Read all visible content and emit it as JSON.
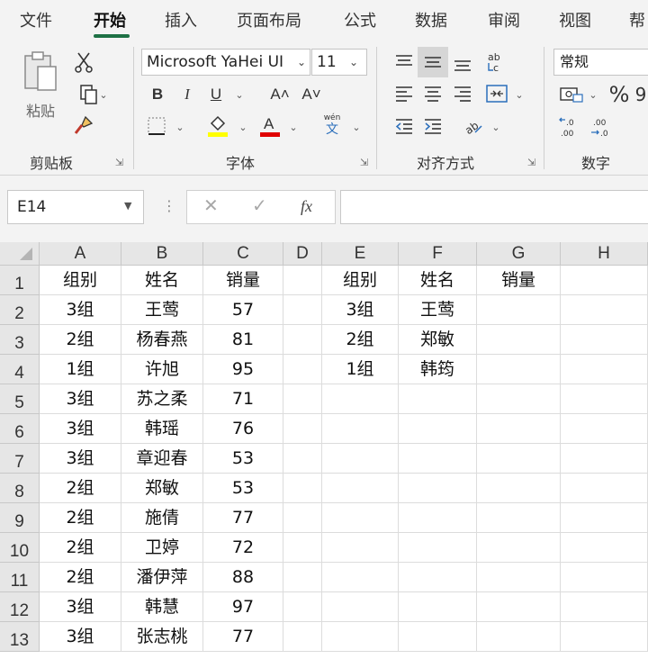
{
  "tabs": [
    "文件",
    "开始",
    "插入",
    "页面布局",
    "公式",
    "数据",
    "审阅",
    "视图",
    "帮"
  ],
  "active_tab_index": 1,
  "ribbon": {
    "clipboard": {
      "paste_label": "粘贴",
      "group_label": "剪贴板"
    },
    "font": {
      "font_name": "Microsoft YaHei UI",
      "font_size": "11",
      "group_label": "字体",
      "phonetic_label": "wén"
    },
    "alignment": {
      "group_label": "对齐方式"
    },
    "number": {
      "format": "常规",
      "group_label": "数字",
      "percent": "%"
    }
  },
  "formula_bar": {
    "name_box": "E14",
    "fx": "fx",
    "formula": ""
  },
  "columns": [
    "A",
    "B",
    "C",
    "D",
    "E",
    "F",
    "G",
    "H"
  ],
  "rows": [
    {
      "num": "1",
      "cells": [
        "组别",
        "姓名",
        "销量",
        "",
        "组别",
        "姓名",
        "销量",
        ""
      ]
    },
    {
      "num": "2",
      "cells": [
        "3组",
        "王莺",
        "57",
        "",
        "3组",
        "王莺",
        "",
        ""
      ]
    },
    {
      "num": "3",
      "cells": [
        "2组",
        "杨春燕",
        "81",
        "",
        "2组",
        "郑敏",
        "",
        ""
      ]
    },
    {
      "num": "4",
      "cells": [
        "1组",
        "许旭",
        "95",
        "",
        "1组",
        "韩筠",
        "",
        ""
      ]
    },
    {
      "num": "5",
      "cells": [
        "3组",
        "苏之柔",
        "71",
        "",
        "",
        "",
        "",
        ""
      ]
    },
    {
      "num": "6",
      "cells": [
        "3组",
        "韩瑶",
        "76",
        "",
        "",
        "",
        "",
        ""
      ]
    },
    {
      "num": "7",
      "cells": [
        "3组",
        "章迎春",
        "53",
        "",
        "",
        "",
        "",
        ""
      ]
    },
    {
      "num": "8",
      "cells": [
        "2组",
        "郑敏",
        "53",
        "",
        "",
        "",
        "",
        ""
      ]
    },
    {
      "num": "9",
      "cells": [
        "2组",
        "施倩",
        "77",
        "",
        "",
        "",
        "",
        ""
      ]
    },
    {
      "num": "10",
      "cells": [
        "2组",
        "卫婷",
        "72",
        "",
        "",
        "",
        "",
        ""
      ]
    },
    {
      "num": "11",
      "cells": [
        "2组",
        "潘伊萍",
        "88",
        "",
        "",
        "",
        "",
        ""
      ]
    },
    {
      "num": "12",
      "cells": [
        "3组",
        "韩慧",
        "97",
        "",
        "",
        "",
        "",
        ""
      ]
    },
    {
      "num": "13",
      "cells": [
        "3组",
        "张志桃",
        "77",
        "",
        "",
        "",
        "",
        ""
      ]
    }
  ],
  "colors": {
    "accent": "#1e7145",
    "highlight": "#ffff00",
    "font_color": "#e00000",
    "header_bg": "#e6e6e6"
  }
}
